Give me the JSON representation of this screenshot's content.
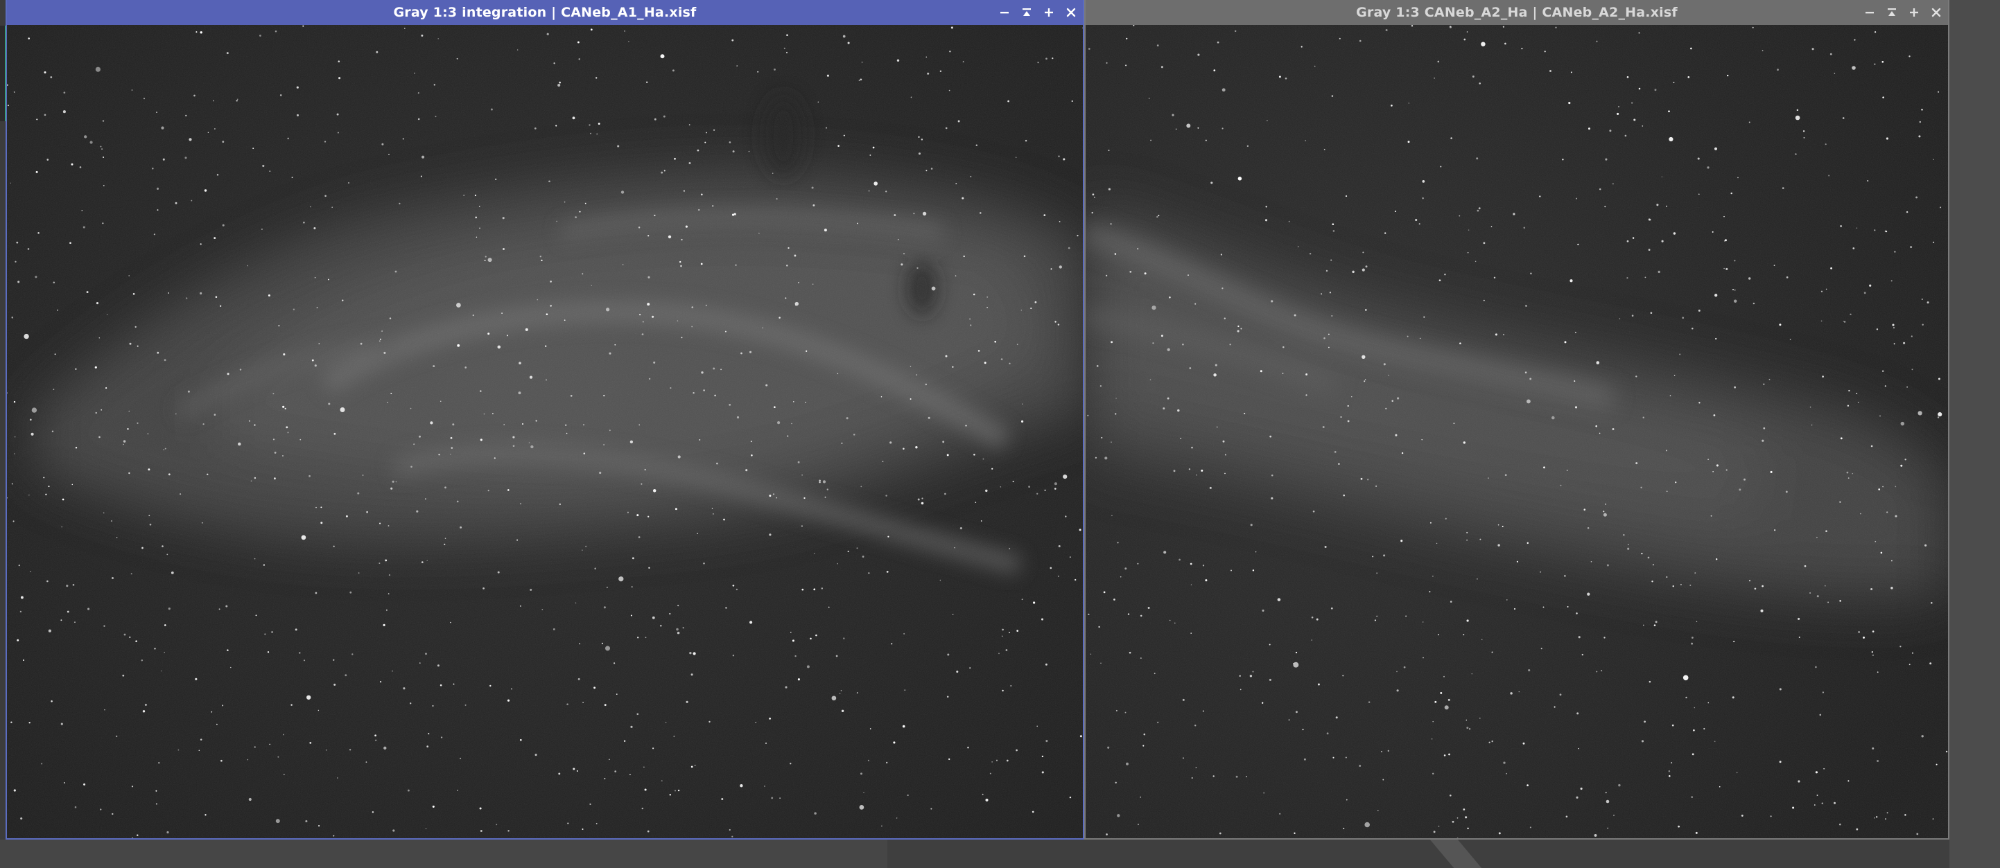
{
  "windows": [
    {
      "id": "view-a",
      "title": "Gray 1:3 integration | CANeb_A1_Ha.xisf",
      "active": true,
      "accent_color": "#5662b6",
      "controls": [
        "minimize-icon",
        "shade-icon",
        "maximize-icon",
        "close-icon"
      ]
    },
    {
      "id": "view-b",
      "title": "Gray 1:3 CANeb_A2_Ha | CANeb_A2_Ha.xisf",
      "active": false,
      "accent_color": "#6e6e6e",
      "controls": [
        "minimize-icon",
        "shade-icon",
        "maximize-icon",
        "close-icon"
      ]
    }
  ],
  "theme": {
    "workspace_bg": "#4a4a4a",
    "active_border": "#5b6cc0",
    "inactive_border": "#7a7a7a",
    "sky_bg": "#262626",
    "nebula": "#9a9a9a",
    "star": "#ffffff"
  }
}
